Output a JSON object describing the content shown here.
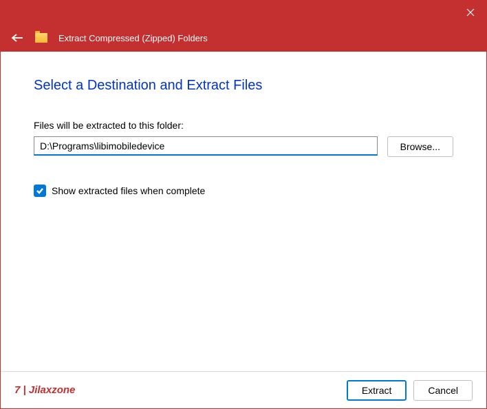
{
  "titlebar": {
    "title": "Extract Compressed (Zipped) Folders"
  },
  "content": {
    "heading": "Select a Destination and Extract Files",
    "path_label": "Files will be extracted to this folder:",
    "path_value": "D:\\Programs\\libimobiledevice",
    "browse_label": "Browse...",
    "show_extracted_checked": true,
    "show_extracted_label": "Show extracted files when complete"
  },
  "footer": {
    "watermark": "7 | Jilaxzone",
    "extract_label": "Extract",
    "cancel_label": "Cancel"
  }
}
